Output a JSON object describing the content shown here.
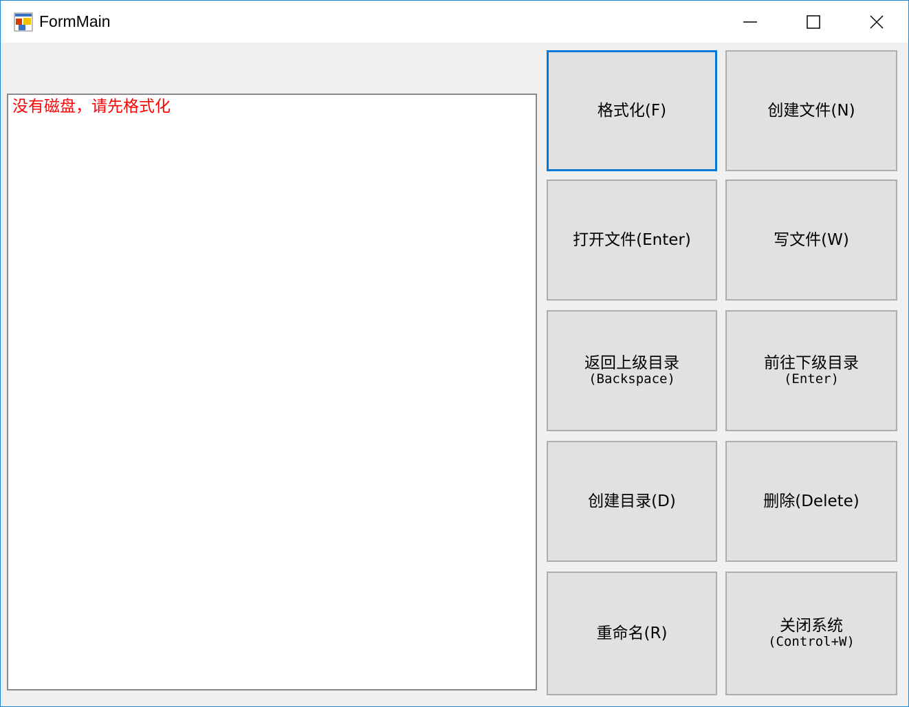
{
  "window": {
    "title": "FormMain",
    "icon": "windows-form-icon"
  },
  "caption_buttons": {
    "minimize": "minimize-icon",
    "maximize": "maximize-icon",
    "close": "close-icon"
  },
  "output": {
    "message": "没有磁盘，请先格式化",
    "message_color": "#ff0000"
  },
  "buttons": {
    "format": {
      "label": "格式化(F)"
    },
    "create_file": {
      "label": "创建文件(N)"
    },
    "open_file": {
      "label": "打开文件(Enter)"
    },
    "write_file": {
      "label": "写文件(W)"
    },
    "go_up": {
      "label": "返回上级目录",
      "shortcut": "(Backspace)"
    },
    "go_down": {
      "label": "前往下级目录",
      "shortcut": "(Enter)"
    },
    "create_dir": {
      "label": "创建目录(D)"
    },
    "delete": {
      "label": "删除(Delete)"
    },
    "rename": {
      "label": "重命名(R)"
    },
    "close_system": {
      "label": "关闭系统",
      "shortcut": "(Control+W)"
    }
  },
  "colors": {
    "window_border": "#1883d7",
    "focus_border": "#0078d7",
    "button_face": "#e1e1e1",
    "form_background": "#f0f0f0"
  }
}
